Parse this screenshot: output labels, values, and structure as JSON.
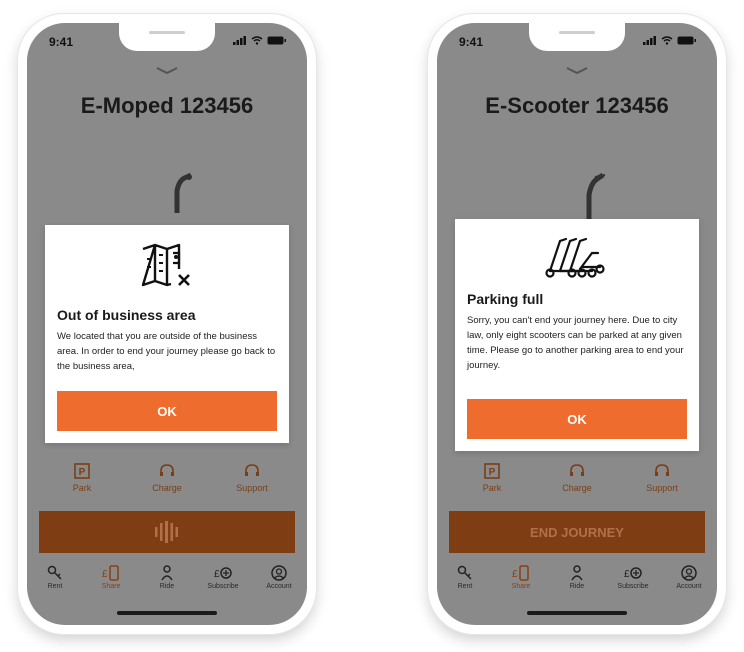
{
  "colors": {
    "accent": "#ee6c2e",
    "overlay_bg": "#8a8a8a",
    "dark_accent": "#7e3d13"
  },
  "phones": [
    {
      "time": "9:41",
      "vehicle_title": "E-Moped 123456",
      "modal": {
        "title": "Out of business area",
        "text": "We located that you are outside of the business area. In order to end your journey please go back to the business area,",
        "button": "OK",
        "icon": "map-out-of-area-icon"
      },
      "actions": [
        {
          "label": "Park"
        },
        {
          "label": "Charge"
        },
        {
          "label": "Support"
        }
      ],
      "end_button": "",
      "tabs": [
        {
          "label": "Rent"
        },
        {
          "label": "Share"
        },
        {
          "label": "Ride"
        },
        {
          "label": "Subscribe"
        },
        {
          "label": "Account"
        }
      ]
    },
    {
      "time": "9:41",
      "vehicle_title": "E-Scooter 123456",
      "modal": {
        "title": "Parking full",
        "text": "Sorry, you can't end your journey here. Due to city law, only eight scooters can be parked at any given time. Please go to another parking area to end your journey.",
        "button": "OK",
        "icon": "scooters-parked-icon"
      },
      "actions": [
        {
          "label": "Park"
        },
        {
          "label": "Charge"
        },
        {
          "label": "Support"
        }
      ],
      "end_button": "END JOURNEY",
      "tabs": [
        {
          "label": "Rent"
        },
        {
          "label": "Share"
        },
        {
          "label": "Ride"
        },
        {
          "label": "Subscribe"
        },
        {
          "label": "Account"
        }
      ]
    }
  ]
}
